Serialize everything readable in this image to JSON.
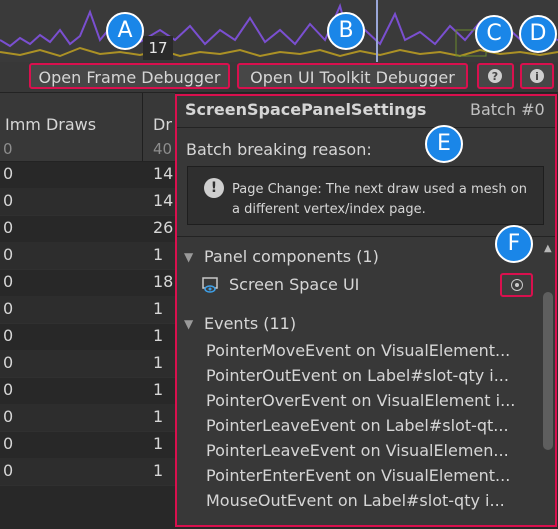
{
  "graph": {
    "frame_number": "17"
  },
  "toolbar": {
    "open_frame_debugger": "Open Frame Debugger",
    "open_ui_toolkit_debugger": "Open UI Toolkit Debugger"
  },
  "table": {
    "columns": [
      {
        "label": "Imm Draws",
        "total": "0"
      },
      {
        "label": "Dr",
        "total": "40"
      }
    ],
    "rows": [
      [
        "0",
        "14"
      ],
      [
        "0",
        "14"
      ],
      [
        "0",
        "26"
      ],
      [
        "0",
        "1"
      ],
      [
        "0",
        "18"
      ],
      [
        "0",
        "1"
      ],
      [
        "0",
        "1"
      ],
      [
        "0",
        "1"
      ],
      [
        "0",
        "1"
      ],
      [
        "0",
        "1"
      ],
      [
        "0",
        "1"
      ],
      [
        "0",
        "1"
      ]
    ]
  },
  "panel": {
    "title": "ScreenSpacePanelSettings",
    "batch": "Batch #0",
    "reason_label": "Batch breaking reason:",
    "reason_text": "Page Change: The next draw used a mesh on a different vertex/index page.",
    "components_header": "Panel components (1)",
    "component_item": "Screen Space UI",
    "events_header": "Events (11)",
    "events": [
      "PointerMoveEvent on VisualElement...",
      "PointerOutEvent on Label#slot-qty i...",
      "PointerOverEvent on VisualElement i...",
      "PointerLeaveEvent on Label#slot-qt...",
      "PointerLeaveEvent on VisualElemen...",
      "PointerEnterEvent on VisualElement...",
      "MouseOutEvent on Label#slot-qty i..."
    ]
  },
  "callouts": [
    "A",
    "B",
    "C",
    "D",
    "E",
    "F"
  ],
  "icons": {
    "help": "question-circle-icon",
    "info": "info-circle-icon",
    "warning": "exclamation-circle-icon",
    "component": "screen-space-ui-icon",
    "locate": "target-icon"
  },
  "colors": {
    "highlight": "#d9104e",
    "callout": "#1a86e8",
    "graph_line": "#7a4fd0",
    "graph_fill": "#c8a820"
  }
}
